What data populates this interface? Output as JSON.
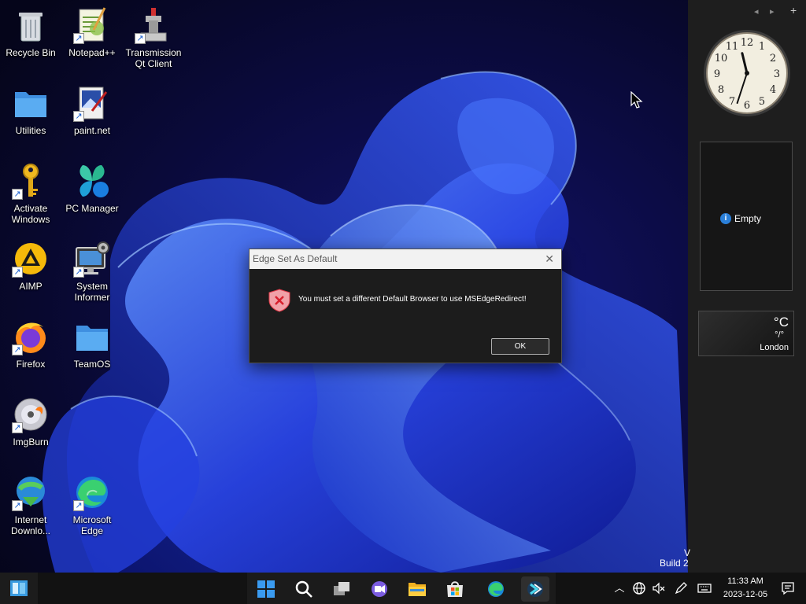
{
  "desktop": {
    "icons": [
      {
        "label": "Recycle Bin"
      },
      {
        "label": "Notepad++"
      },
      {
        "label": "Transmission Qt Client"
      },
      {
        "label": "Utilities"
      },
      {
        "label": "paint.net"
      },
      {
        "label": "Activate Windows"
      },
      {
        "label": "PC Manager"
      },
      {
        "label": "AIMP"
      },
      {
        "label": "System Informer"
      },
      {
        "label": "Firefox"
      },
      {
        "label": "TeamOS"
      },
      {
        "label": "ImgBurn"
      },
      {
        "label": "Internet Downlo..."
      },
      {
        "label": "Microsoft Edge"
      }
    ],
    "build_text": "Build 2",
    "build_text_top": "V"
  },
  "sidebar": {
    "nav_prev": "◂",
    "nav_next": "▸",
    "add": "+",
    "clock": {
      "hour_numbers": [
        "12",
        "1",
        "2",
        "3",
        "4",
        "5",
        "6",
        "7",
        "8",
        "9",
        "10",
        "11"
      ],
      "time_shown": "11:33"
    },
    "slideshow": {
      "info_glyph": "i",
      "label": "Empty"
    },
    "weather": {
      "unit": "°C",
      "temperature": "°/°",
      "city": "London"
    }
  },
  "dialog": {
    "title": "Edge Set As Default",
    "close_glyph": "✕",
    "message": "You must set a different Default Browser to use MSEdgeRedirect!",
    "ok_label": "OK"
  },
  "taskbar": {
    "apps": [
      "Start",
      "Search",
      "Task View",
      "Chat",
      "File Explorer",
      "Microsoft Store",
      "Microsoft Edge",
      "MSEdgeRedirect"
    ],
    "tray": {
      "chevron": "︿",
      "time": "11:33 AM",
      "date": "2023-12-05"
    }
  },
  "colors": {
    "wallpaper_base": "#06061a",
    "bloom_blue": "#1f3fe0",
    "sidebar_bg": "#1e1e1e",
    "taskbar_bg": "#121212",
    "dialog_bg": "#1c1c1c",
    "accent_blue": "#2a7fd8",
    "error_red": "#e23c4a"
  }
}
